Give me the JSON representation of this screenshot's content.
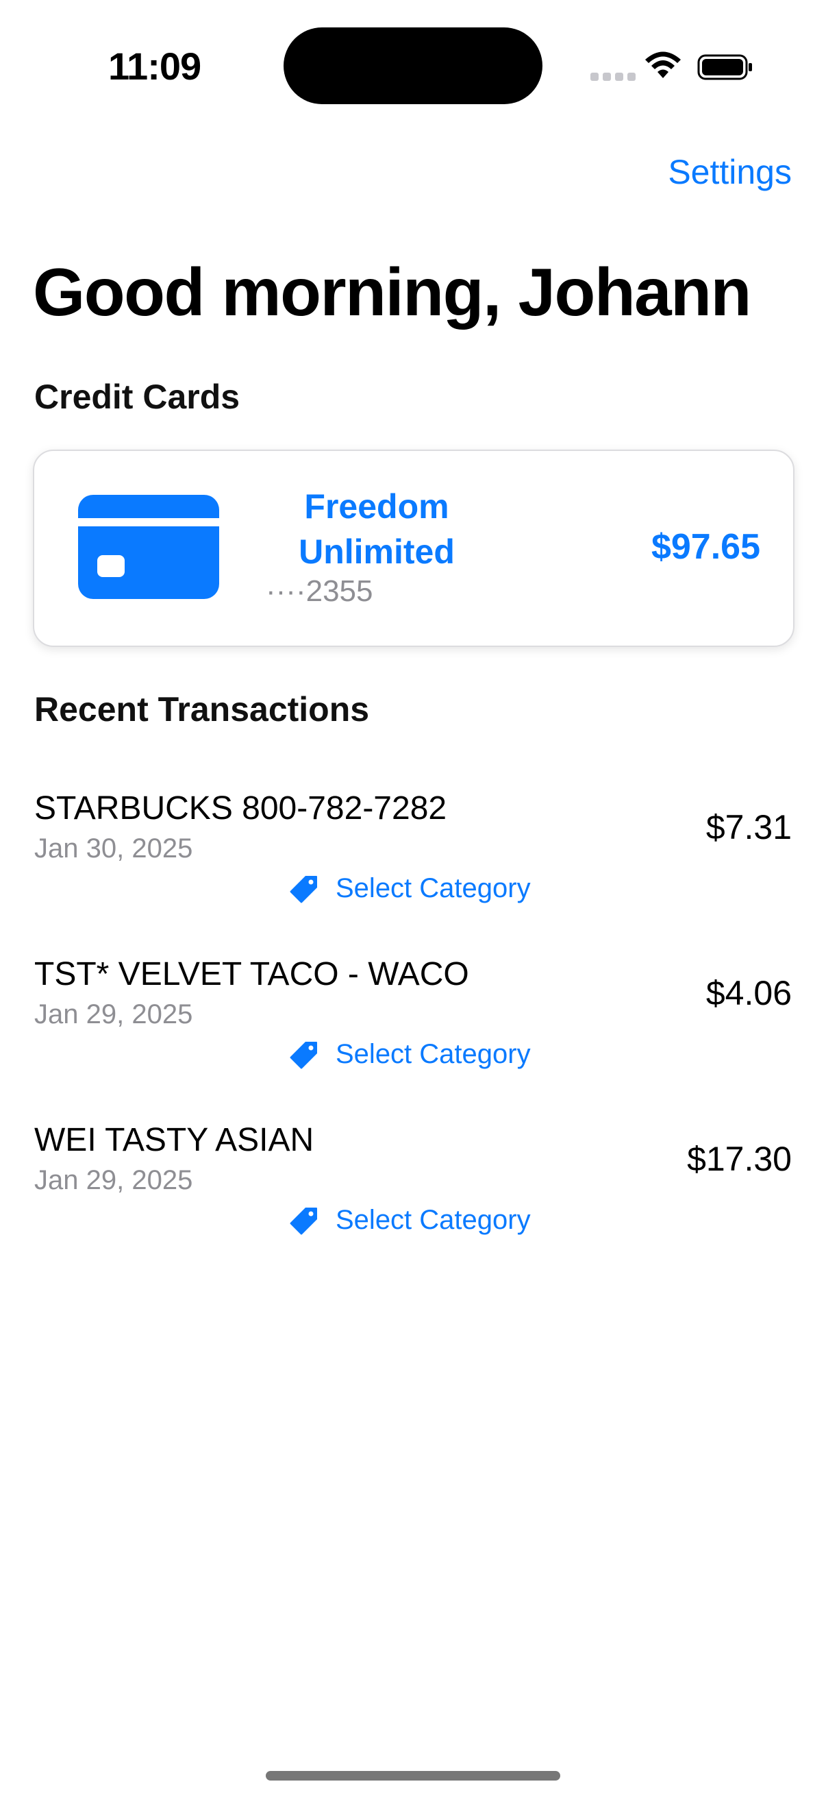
{
  "status_bar": {
    "time": "11:09"
  },
  "header": {
    "settings_label": "Settings",
    "greeting": "Good morning, Johann"
  },
  "credit_cards": {
    "section_title": "Credit Cards",
    "cards": [
      {
        "name": "Freedom Unlimited",
        "number": "····2355",
        "balance": "$97.65",
        "icon": "credit-card-icon"
      }
    ]
  },
  "transactions": {
    "section_title": "Recent Transactions",
    "items": [
      {
        "merchant": "STARBUCKS 800-782-7282",
        "date": "Jan 30, 2025",
        "amount": "$7.31",
        "category_label": "Select Category"
      },
      {
        "merchant": "TST* VELVET TACO - WACO",
        "date": "Jan 29, 2025",
        "amount": "$4.06",
        "category_label": "Select Category"
      },
      {
        "merchant": "WEI TASTY ASIAN",
        "date": "Jan 29, 2025",
        "amount": "$17.30",
        "category_label": "Select Category"
      }
    ]
  },
  "colors": {
    "accent": "#0a7aff",
    "secondary_text": "#8e8e93"
  }
}
